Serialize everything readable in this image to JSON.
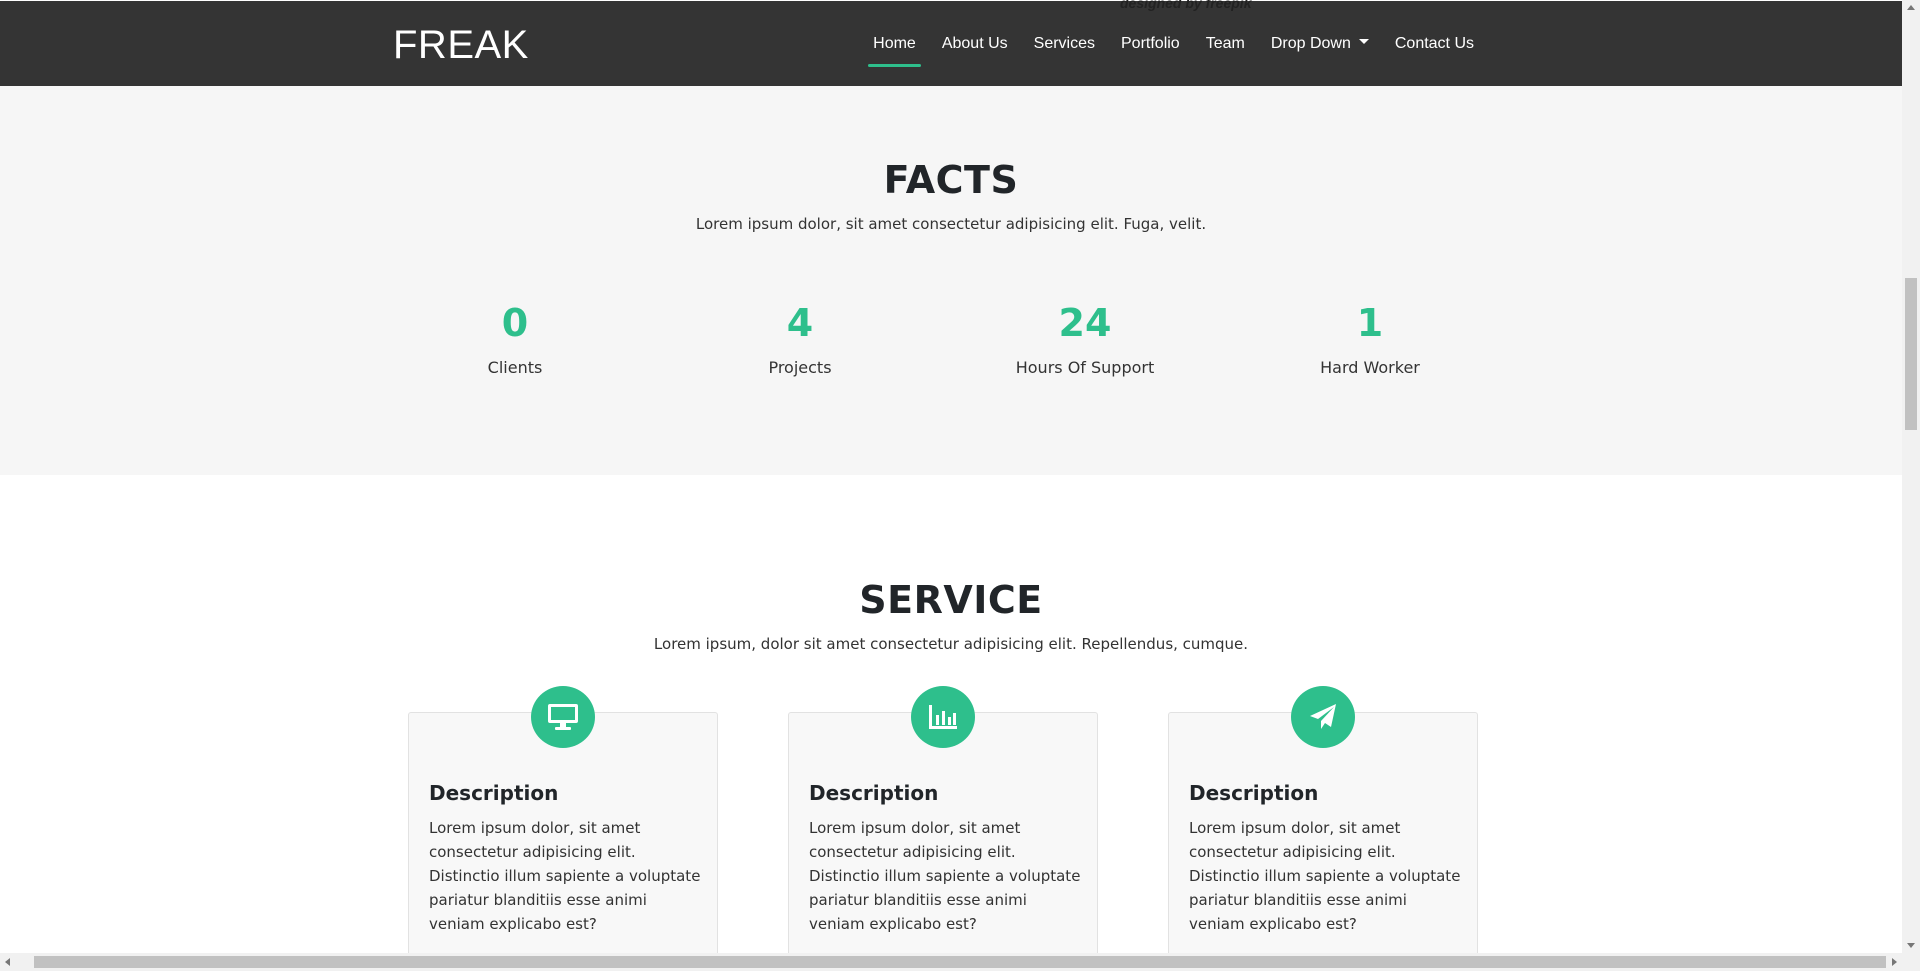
{
  "navbar": {
    "brand": "FREAK",
    "watermark": "designed by freepik",
    "links": [
      {
        "label": "Home",
        "active": true
      },
      {
        "label": "About Us"
      },
      {
        "label": "Services"
      },
      {
        "label": "Portfolio"
      },
      {
        "label": "Team"
      },
      {
        "label": "Drop Down",
        "dropdown": true
      },
      {
        "label": "Contact Us"
      }
    ]
  },
  "facts": {
    "title": "FACTS",
    "subtitle": "Lorem ipsum dolor, sit amet consectetur adipisicing elit. Fuga, velit.",
    "items": [
      {
        "value": "0",
        "label": "Clients"
      },
      {
        "value": "4",
        "label": "Projects"
      },
      {
        "value": "24",
        "label": "Hours Of Support"
      },
      {
        "value": "1",
        "label": "Hard Worker"
      }
    ]
  },
  "service": {
    "title": "SERVICE",
    "subtitle": "Lorem ipsum, dolor sit amet consectetur adipisicing elit. Repellendus, cumque.",
    "cards": [
      {
        "icon": "desktop-icon",
        "title": "Description",
        "text": "Lorem ipsum dolor, sit amet consectetur adipisicing elit. Distinctio illum sapiente a voluptate pariatur blanditiis esse animi veniam explicabo est?"
      },
      {
        "icon": "chart-bar-icon",
        "title": "Description",
        "text": "Lorem ipsum dolor, sit amet consectetur adipisicing elit. Distinctio illum sapiente a voluptate pariatur blanditiis esse animi veniam explicabo est?"
      },
      {
        "icon": "paper-plane-icon",
        "title": "Description",
        "text": "Lorem ipsum dolor, sit amet consectetur adipisicing elit. Distinctio illum sapiente a voluptate pariatur blanditiis esse animi veniam explicabo est?"
      }
    ]
  },
  "colors": {
    "navbar_bg": "#343434",
    "accent": "#2ebf8c",
    "facts_bg": "#f6f6f6"
  }
}
